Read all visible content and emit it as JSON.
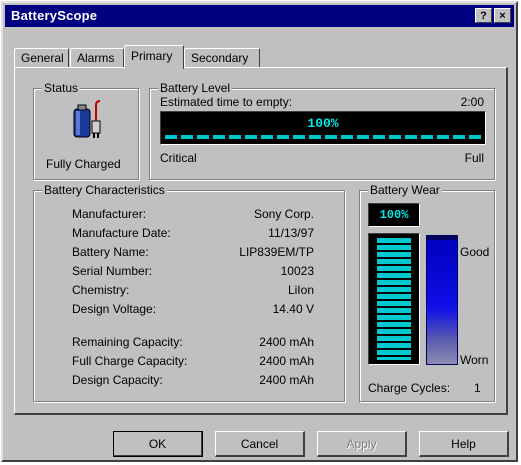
{
  "window": {
    "title": "BatteryScope",
    "help_btn": "?",
    "close_btn": "×"
  },
  "tabs": [
    {
      "label": "General"
    },
    {
      "label": "Alarms"
    },
    {
      "label": "Primary",
      "active": true
    },
    {
      "label": "Secondary"
    }
  ],
  "status": {
    "title": "Status",
    "icon": "battery-plug-icon",
    "text": "Fully Charged"
  },
  "battery_level": {
    "title": "Battery Level",
    "estimated_label": "Estimated time to empty:",
    "estimated_value": "2:00",
    "percent_text": "100%",
    "fraction": 1.0,
    "low_label": "Critical",
    "high_label": "Full"
  },
  "characteristics": {
    "title": "Battery Characteristics",
    "rows": [
      {
        "label": "Manufacturer:",
        "value": "Sony Corp."
      },
      {
        "label": "Manufacture Date:",
        "value": "11/13/97"
      },
      {
        "label": "Battery Name:",
        "value": "LIP839EM/TP"
      },
      {
        "label": "Serial Number:",
        "value": "10023"
      },
      {
        "label": "Chemistry:",
        "value": "LiIon"
      },
      {
        "label": "Design Voltage:",
        "value": "14.40 V"
      }
    ],
    "capacity_rows": [
      {
        "label": "Remaining Capacity:",
        "value": "2400 mAh"
      },
      {
        "label": "Full Charge Capacity:",
        "value": "2400 mAh"
      },
      {
        "label": "Design Capacity:",
        "value": "2400 mAh"
      }
    ]
  },
  "wear": {
    "title": "Battery Wear",
    "percent_text": "100%",
    "fraction": 1.0,
    "good_label": "Good",
    "worn_label": "Worn",
    "cycles_label": "Charge Cycles:",
    "cycles_value": "1"
  },
  "buttons": {
    "ok": "OK",
    "cancel": "Cancel",
    "apply": "Apply",
    "help": "Help"
  },
  "colors": {
    "title_bar": "#000080",
    "lcd_text": "#00e8e8",
    "wear_gradient_top": "#0000c0"
  }
}
